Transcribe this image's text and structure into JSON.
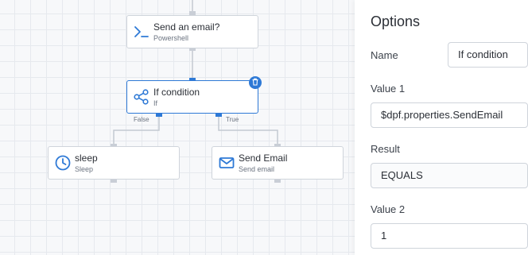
{
  "workflow": {
    "nodes": {
      "send_email_q": {
        "title": "Send an email?",
        "subtitle": "Powershell",
        "icon": "terminal-icon"
      },
      "if_condition": {
        "title": "If condition",
        "subtitle": "If",
        "icon": "share-icon"
      },
      "sleep": {
        "title": "sleep",
        "subtitle": "Sleep",
        "icon": "clock-icon"
      },
      "send_email": {
        "title": "Send Email",
        "subtitle": "Send email",
        "icon": "mail-icon"
      }
    },
    "edge_labels": {
      "false": "False",
      "true": "True"
    }
  },
  "options": {
    "title": "Options",
    "name_label": "Name",
    "name_value": "If condition",
    "value1_label": "Value 1",
    "value1_value": "$dpf.properties.SendEmail",
    "result_label": "Result",
    "result_value": "EQUALS",
    "value2_label": "Value 2",
    "value2_value": "1"
  },
  "colors": {
    "accent": "#2e79d6",
    "border": "#cfd4db",
    "text": "#2b2f36"
  }
}
